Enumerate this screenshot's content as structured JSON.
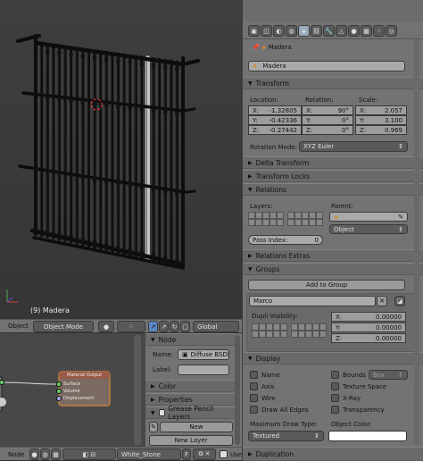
{
  "viewport": {
    "object_label": "(9) Madera"
  },
  "view3d_header": {
    "object_menu": "Object",
    "mode": "Object Mode",
    "orientation": "Global"
  },
  "props": {
    "breadcrumb": "Madera",
    "object_name": "Madera",
    "transform": {
      "title": "Transform",
      "location_label": "Location:",
      "rotation_label": "Rotation:",
      "scale_label": "Scale:",
      "location": [
        [
          "X:",
          "-1.32805"
        ],
        [
          "Y:",
          "-0.42336"
        ],
        [
          "Z:",
          "-0.27442"
        ]
      ],
      "rotation": [
        [
          "X:",
          "90°"
        ],
        [
          "Y:",
          "0°"
        ],
        [
          "Z:",
          "0°"
        ]
      ],
      "scale": [
        [
          "X:",
          "2.057"
        ],
        [
          "Y:",
          "3.100"
        ],
        [
          "Z:",
          "0.969"
        ]
      ],
      "rotation_mode_label": "Rotation Mode:",
      "rotation_mode": "XYZ Euler"
    },
    "delta_transform": "Delta Transform",
    "transform_locks": "Transform Locks",
    "relations": {
      "title": "Relations",
      "layers_label": "Layers:",
      "parent_label": "Parent:",
      "parent_type": "Object",
      "pass_index_label": "Pass Index:",
      "pass_index": "0"
    },
    "relations_extras": "Relations Extras",
    "groups": {
      "title": "Groups",
      "add_button": "Add to Group",
      "group_name": "Marco",
      "dupli_label": "Dupli Visibility:",
      "offset": [
        [
          "X:",
          "0.00000"
        ],
        [
          "Y:",
          "0.00000"
        ],
        [
          "Z:",
          "0.00000"
        ]
      ]
    },
    "display": {
      "title": "Display",
      "name": "Name",
      "axis": "Axis",
      "wire": "Wire",
      "draw_all_edges": "Draw All Edges",
      "bounds": "Bounds",
      "bounds_type": "Box",
      "texture_space": "Texture Space",
      "xray": "X-Ray",
      "transparency": "Transparency",
      "max_draw_label": "Maximum Draw Type:",
      "max_draw": "Textured",
      "object_color_label": "Object Color:"
    },
    "duplication": "Duplication"
  },
  "node_editor": {
    "node_title": "Material Output",
    "sockets": [
      "Surface",
      "Volume",
      "Displacement"
    ]
  },
  "node_props": {
    "node_section": "Node",
    "name_label": "Name:",
    "name_value": "Diffuse BSDF",
    "label_label": "Label:",
    "color": "Color",
    "properties": "Properties",
    "grease": "Grease Pencil Layers",
    "new": "New",
    "new_layer": "New Layer"
  },
  "node_header": {
    "menu": "Node",
    "material": "White_Stone",
    "f_label": "F",
    "use_label": "Use"
  }
}
